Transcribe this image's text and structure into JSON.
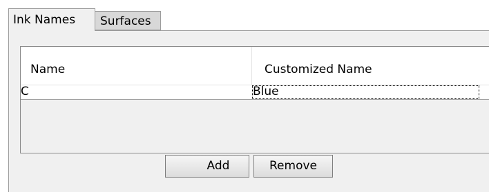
{
  "tabs": [
    {
      "label": "Ink Names",
      "active": true
    },
    {
      "label": "Surfaces",
      "active": false
    }
  ],
  "table": {
    "columns": [
      "Name",
      "Customized Name"
    ],
    "rows": [
      {
        "name": "C",
        "customized_name": "Blue"
      }
    ]
  },
  "buttons": {
    "add_label": "Add",
    "remove_label": "Remove"
  }
}
